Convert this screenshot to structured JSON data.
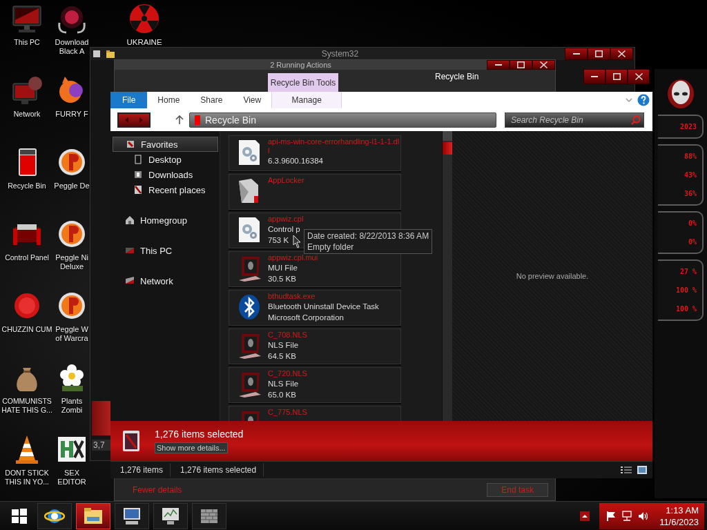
{
  "desktop": {
    "columns": [
      [
        {
          "label": "This PC",
          "kind": "monitor"
        },
        {
          "label": "Network",
          "kind": "network"
        },
        {
          "label": "Recycle Bin",
          "kind": "bin"
        },
        {
          "label": "Control Panel",
          "kind": "panel"
        },
        {
          "label": "CHUZZIN CUM",
          "kind": "furball"
        },
        {
          "label": "COMMUNISTS HATE THIS G...",
          "kind": "moneybag"
        },
        {
          "label": "DONT STICK THIS IN YO...",
          "kind": "cone"
        }
      ],
      [
        {
          "label": "Download Black A",
          "kind": "orb"
        },
        {
          "label": "FURRY F",
          "kind": "fox"
        },
        {
          "label": "Peggle De",
          "kind": "ball"
        },
        {
          "label": "Peggle Ni Deluxe",
          "kind": "ball"
        },
        {
          "label": "Peggle W of Warcra",
          "kind": "ball"
        },
        {
          "label": "Plants Zombi",
          "kind": "flower"
        },
        {
          "label": "SEX EDITOR",
          "kind": "hex"
        }
      ],
      [
        {
          "label": "UKRAINE",
          "kind": "radiation"
        }
      ]
    ]
  },
  "folder_window": {
    "title": "System32",
    "count": "3,7"
  },
  "task_manager": {
    "title": "2 Running Actions",
    "fewer_details": "Fewer details",
    "end_task": "End task"
  },
  "explorer": {
    "title": "Recycle Bin",
    "context_group": "Recycle Bin Tools",
    "tabs": [
      {
        "label": "File",
        "selected": true,
        "contextual": false
      },
      {
        "label": "Home",
        "selected": false,
        "contextual": false
      },
      {
        "label": "Share",
        "selected": false,
        "contextual": false
      },
      {
        "label": "View",
        "selected": false,
        "contextual": false
      },
      {
        "label": "Manage",
        "selected": false,
        "contextual": true
      }
    ],
    "address": "Recycle Bin",
    "search": {
      "placeholder": "Search Recycle Bin"
    },
    "nav": [
      {
        "label": "Favorites",
        "kind": "star",
        "selected": true,
        "children": [
          {
            "label": "Desktop",
            "kind": "desktop",
            "selected": false
          },
          {
            "label": "Downloads",
            "kind": "downloads",
            "selected": false
          },
          {
            "label": "Recent places",
            "kind": "recent",
            "selected": false
          }
        ]
      },
      {
        "label": "Homegroup",
        "kind": "home",
        "selected": false
      },
      {
        "label": "This PC",
        "kind": "pc",
        "selected": false
      },
      {
        "label": "Network",
        "kind": "network",
        "selected": false
      }
    ],
    "files": [
      {
        "name": "api-ms-win-core-errorhandling-l1-1-1.dll",
        "kind": "gear",
        "lines": [
          "6.3.9600.16384"
        ]
      },
      {
        "name": "AppLocker",
        "kind": "applocker"
      },
      {
        "name": "appwiz.cpl",
        "kind": "gear",
        "lines": [
          "Control p",
          "753 K"
        ]
      },
      {
        "name": "appwiz.cpl.mui",
        "kind": "mui",
        "lines": [
          "MUI File",
          "30.5 KB"
        ]
      },
      {
        "name": "bthudtask.exe",
        "kind": "bluetooth",
        "lines": [
          "Bluetooth Uninstall Device Task",
          "Microsoft Corporation"
        ]
      },
      {
        "name": "C_708.NLS",
        "kind": "mui",
        "lines": [
          "NLS File",
          "64.5 KB"
        ]
      },
      {
        "name": "C_720.NLS",
        "kind": "mui",
        "lines": [
          "NLS File",
          "65.0 KB"
        ]
      },
      {
        "name": "C_775.NLS",
        "kind": "mui"
      }
    ],
    "tooltip": [
      "Date created: 8/22/2013 8:36 AM",
      "Empty folder"
    ],
    "preview": "No preview available.",
    "details": {
      "title": "1,276 items selected",
      "link": "Show more details..."
    },
    "status": [
      "1,276 items",
      "1,276 items selected"
    ]
  },
  "gadget": {
    "date_fragment": "2023",
    "readings": [
      "88%",
      "43%",
      "36%",
      "0%",
      "0%",
      "27 %",
      "100 %",
      "100 %"
    ]
  },
  "taskbar": {
    "apps": [
      {
        "kind": "ie",
        "active": false
      },
      {
        "kind": "explorer",
        "active": true
      },
      {
        "kind": "computer",
        "active": false
      },
      {
        "kind": "monitor",
        "active": false
      },
      {
        "kind": "wall",
        "active": false
      }
    ],
    "time": "1:13 AM",
    "date": "11/6/2023"
  }
}
